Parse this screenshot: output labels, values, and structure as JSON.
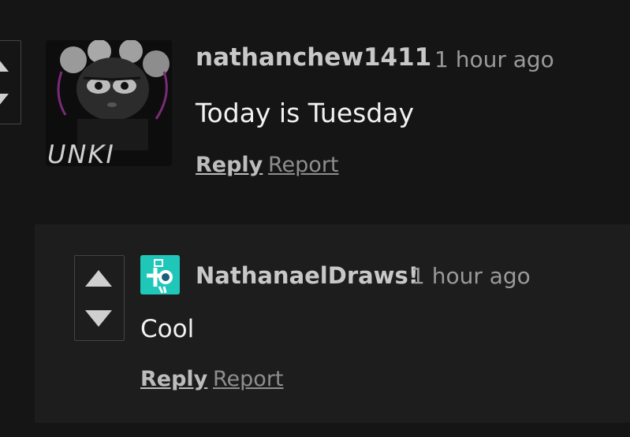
{
  "comments": [
    {
      "author": "nathanchew1411",
      "time": "1 hour ago",
      "text": "Today is Tuesday",
      "avatar_text": "UNKI",
      "reply_label": "Reply",
      "report_label": "Report"
    },
    {
      "author": "NathanaelDraws!",
      "time": "1 hour ago",
      "text": "Cool",
      "reply_label": "Reply",
      "report_label": "Report"
    }
  ],
  "colors": {
    "background": "#151515",
    "reply_panel": "#1d1d1d",
    "avatar2_bg": "#1fc7b8"
  },
  "icons": {
    "upvote": "triangle-up-icon",
    "downvote": "triangle-down-icon"
  }
}
